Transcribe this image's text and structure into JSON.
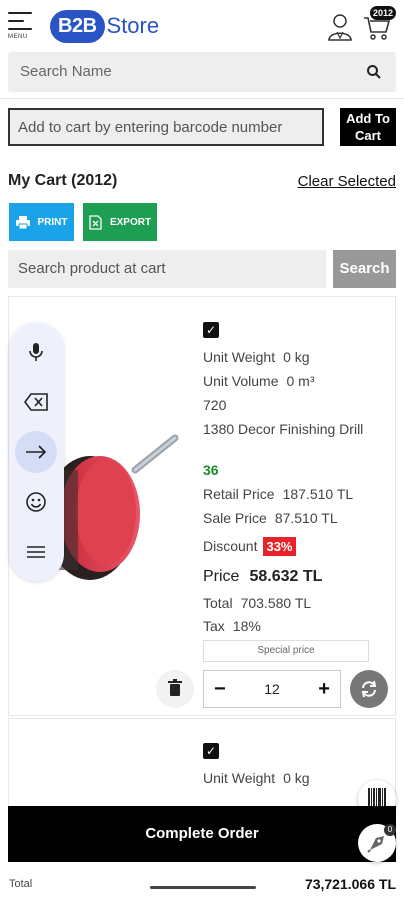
{
  "header": {
    "menu_label": "MENU",
    "logo_b2b": "B2B",
    "logo_store": "Store",
    "cart_badge": "2012"
  },
  "search": {
    "placeholder": "Search Name"
  },
  "barcode": {
    "placeholder": "Add to cart by entering barcode number",
    "add_button": "Add To Cart"
  },
  "cart": {
    "title": "My Cart (2012)",
    "clear_selected": "Clear Selected",
    "print_label": "PRINT",
    "export_label": "EXPORT",
    "search_placeholder": "Search product at cart",
    "search_button": "Search"
  },
  "item1": {
    "unit_weight_label": "Unit Weight",
    "unit_weight_value": "0 kg",
    "unit_volume_label": "Unit Volume",
    "unit_volume_value": "0 m³",
    "code": "720",
    "name": "1380 Decor Finishing Drill",
    "stock": "36",
    "retail_price_label": "Retail Price",
    "retail_price_value": "187.510 TL",
    "sale_price_label": "Sale Price",
    "sale_price_value": "87.510 TL",
    "discount_label": "Discount",
    "discount_value": "33%",
    "price_label": "Price",
    "price_value": "58.632 TL",
    "total_label": "Total",
    "total_value": "703.580 TL",
    "tax_label": "Tax",
    "tax_value": "18%",
    "special_price": "Special price",
    "quantity": "12",
    "minus": "−",
    "plus": "+"
  },
  "item2": {
    "unit_weight_label": "Unit Weight",
    "unit_weight_value": "0 kg"
  },
  "footer": {
    "complete_order": "Complete Order",
    "total_label": "Total",
    "total_value": "73,721.066 TL",
    "rocket_badge": "0"
  },
  "colors": {
    "brand": "#2a54c4",
    "print": "#1aa3e8",
    "export": "#1e9e52",
    "discount": "#e8242a",
    "stock": "#1a8c2a"
  },
  "icons": [
    "hamburger-icon",
    "user-icon",
    "cart-icon",
    "search-icon",
    "printer-icon",
    "excel-icon",
    "trash-icon",
    "refresh-icon",
    "mic-icon",
    "backspace-icon",
    "arrow-right-icon",
    "emoji-icon",
    "keyboard-menu-icon",
    "barcode-icon",
    "rocket-icon",
    "checkbox-icon"
  ]
}
